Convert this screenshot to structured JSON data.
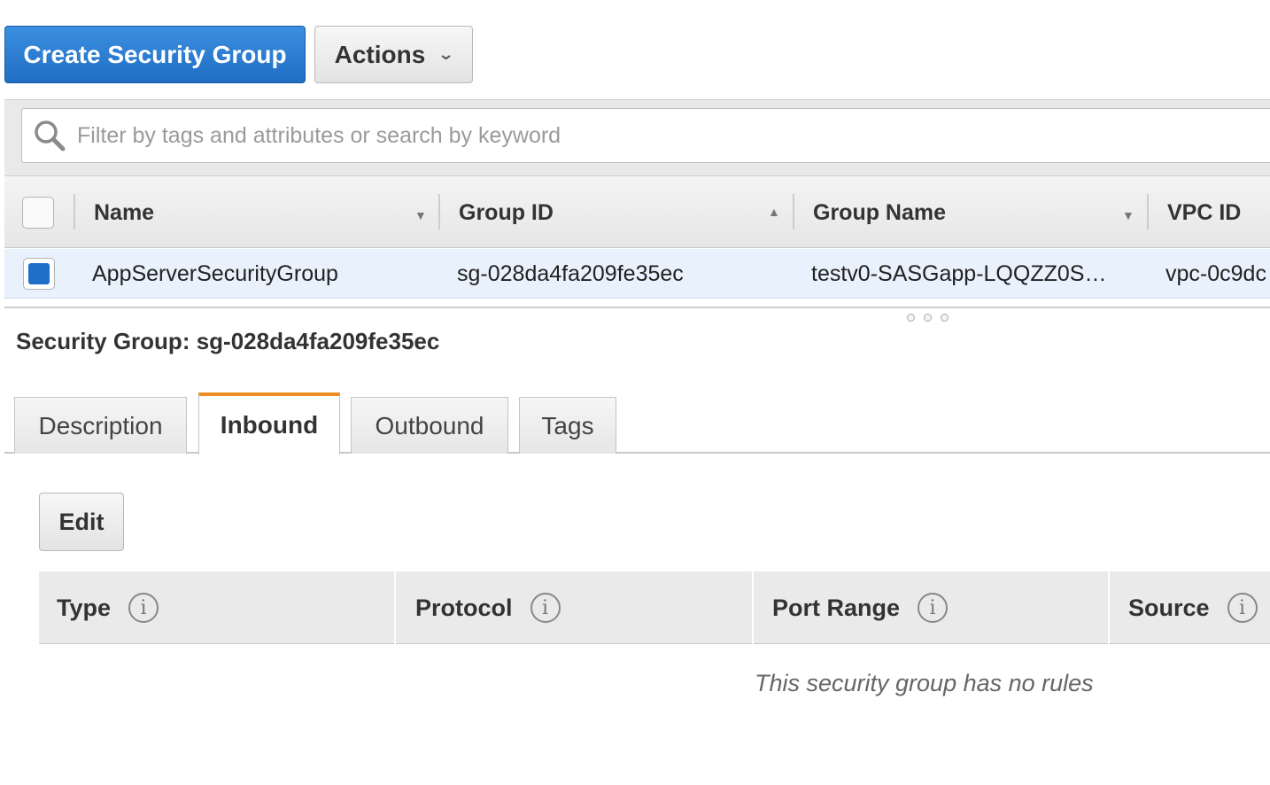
{
  "toolbar": {
    "create_label": "Create Security Group",
    "actions_label": "Actions",
    "actions_caret": "⌄"
  },
  "filter": {
    "placeholder": "Filter by tags and attributes or search by keyword",
    "icon": "search-icon"
  },
  "grid": {
    "columns": [
      {
        "label": "Name",
        "sort": "▼"
      },
      {
        "label": "Group ID",
        "sort": "▲"
      },
      {
        "label": "Group Name",
        "sort": "▼"
      },
      {
        "label": "VPC ID",
        "sort": ""
      }
    ],
    "rows": [
      {
        "selected": true,
        "name": "AppServerSecurityGroup",
        "group_id": "sg-028da4fa209fe35ec",
        "group_name": "testv0-SASGapp-LQQZZ0S…",
        "vpc_id": "vpc-0c9dc"
      }
    ]
  },
  "detail": {
    "title": "Security Group: sg-028da4fa209fe35ec",
    "tabs": [
      "Description",
      "Inbound",
      "Outbound",
      "Tags"
    ],
    "active_tab": "Inbound",
    "edit_label": "Edit",
    "rules_columns": [
      "Type",
      "Protocol",
      "Port Range",
      "Source"
    ],
    "info_glyph": "i",
    "empty_message": "This security group has no rules"
  },
  "colors": {
    "primary": "#1f6ec4",
    "active_tab_accent": "#ec8d22",
    "selected_row": "#e8f1fc"
  }
}
